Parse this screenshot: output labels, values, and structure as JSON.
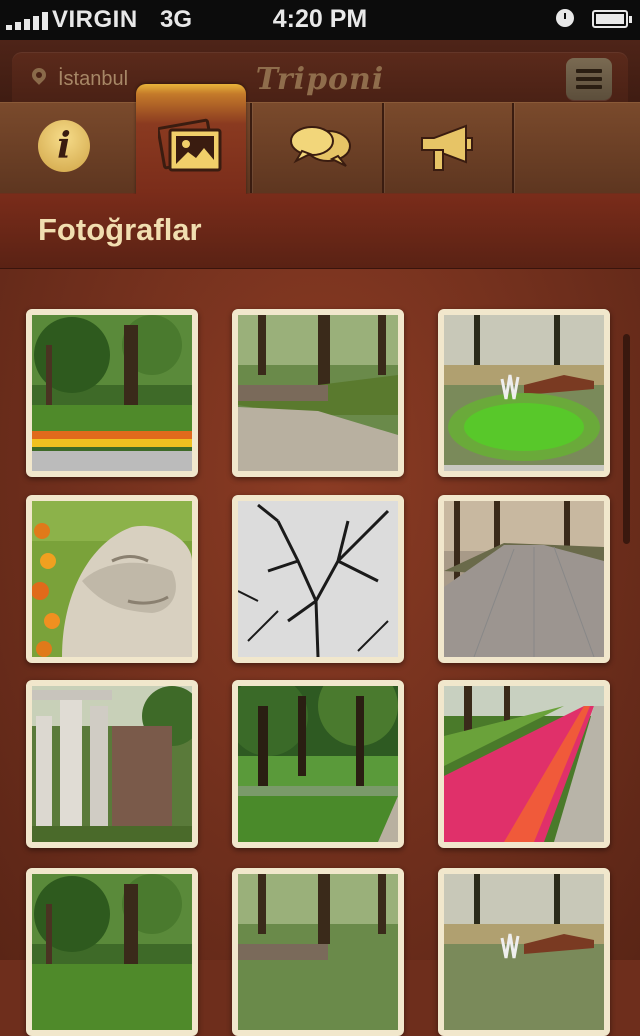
{
  "status_bar": {
    "carrier": "VIRGIN",
    "network": "3G",
    "time": "4:20 PM",
    "battery_level": 1.0,
    "signal_bars": 5
  },
  "header": {
    "location": "İstanbul",
    "logo": "Triponi",
    "location_icon": "map-pin-icon",
    "menu_icon": "list-menu-icon"
  },
  "tabs": [
    {
      "name": "info",
      "icon": "info-icon",
      "active": false
    },
    {
      "name": "photos",
      "icon": "photo-icon",
      "active": true
    },
    {
      "name": "comments",
      "icon": "chat-bubbles-icon",
      "active": false
    },
    {
      "name": "announce",
      "icon": "megaphone-icon",
      "active": false
    }
  ],
  "page": {
    "title": "Fotoğraflar"
  },
  "photos": [
    {
      "scene": "tulip-park"
    },
    {
      "scene": "garden-path"
    },
    {
      "scene": "fountain-pond"
    },
    {
      "scene": "lion-statue"
    },
    {
      "scene": "bare-branches"
    },
    {
      "scene": "paved-walkway"
    },
    {
      "scene": "ruins-columns"
    },
    {
      "scene": "lawn-trees"
    },
    {
      "scene": "tulip-beds"
    },
    {
      "scene": "tulip-park"
    },
    {
      "scene": "garden-path"
    },
    {
      "scene": "fountain-pond"
    }
  ],
  "colors": {
    "accent": "#e8b43a",
    "title_text": "#f1deb0",
    "background": "#6e2e1c",
    "frame": "#f1e7cc"
  }
}
